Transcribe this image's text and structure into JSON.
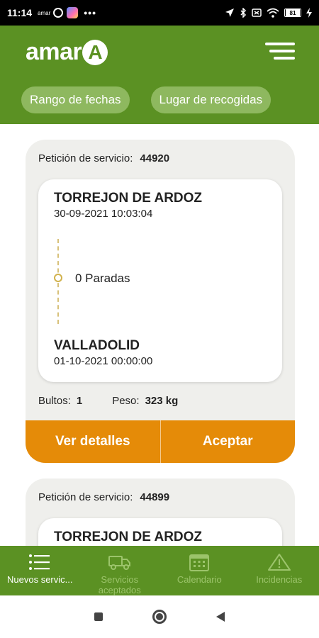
{
  "status_bar": {
    "time": "11:14",
    "carrier": "amar",
    "battery": "81"
  },
  "app": {
    "logo_text": "amar",
    "logo_letter": "A"
  },
  "filters": [
    {
      "label": "Rango de fechas"
    },
    {
      "label": "Lugar de recogidas"
    }
  ],
  "requests": [
    {
      "label": "Petición de servicio:",
      "number": "44920",
      "origin_city": "TORREJON DE ARDOZ",
      "origin_date": "30-09-2021 10:03:04",
      "stops": "0 Paradas",
      "dest_city": "VALLADOLID",
      "dest_date": "01-10-2021 00:00:00",
      "bultos_label": "Bultos:",
      "bultos_value": "1",
      "peso_label": "Peso:",
      "peso_value": "323 kg",
      "details_label": "Ver detalles",
      "accept_label": "Aceptar"
    },
    {
      "label": "Petición de servicio:",
      "number": "44899",
      "origin_city": "TORREJON DE ARDOZ"
    }
  ],
  "bottom_nav": [
    {
      "label": "Nuevos servic...",
      "icon": "list-icon",
      "active": true
    },
    {
      "label": "Servicios aceptados",
      "icon": "truck-icon",
      "active": false
    },
    {
      "label": "Calendario",
      "icon": "calendar-icon",
      "active": false
    },
    {
      "label": "Incidencias",
      "icon": "warning-icon",
      "active": false
    }
  ],
  "colors": {
    "brand_green": "#5b9123",
    "accent_orange": "#e58b08",
    "card_bg": "#efefec"
  }
}
